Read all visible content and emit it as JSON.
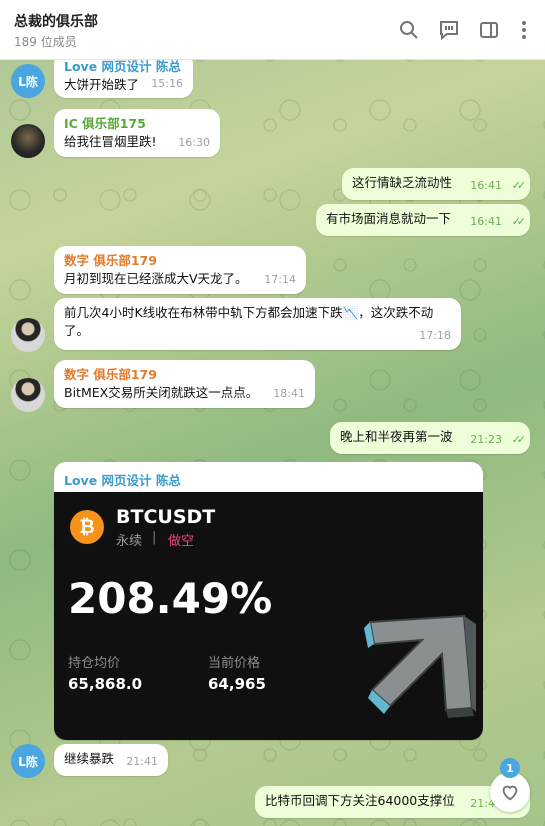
{
  "header": {
    "title": "总裁的俱乐部",
    "subtitle": "189 位成员"
  },
  "icons": {
    "search": "search-icon",
    "comments": "comments-icon",
    "sidebar": "sidebar-icon",
    "more": "more-vert-icon",
    "heart": "heart-icon"
  },
  "colors": {
    "love_sender": "#3a9bd0",
    "ic_sender": "#5ba83a",
    "digit_sender": "#e07b2f",
    "outgoing_bg": "#eefed9",
    "read_check": "#5fae4f"
  },
  "messages": [
    {
      "avatar": "L陈",
      "sender": "Love 网页设计 陈总",
      "text": "大饼开始跌了",
      "time": "15:16"
    },
    {
      "sender": "IC 俱乐部",
      "sender_num": "175",
      "text": "给我往冒烟里跌!",
      "time": "16:30"
    },
    {
      "text": "这行情缺乏流动性",
      "time": "16:41",
      "check": "✓✓"
    },
    {
      "text": "有市场面消息就动一下",
      "time": "16:41",
      "check": "✓✓"
    },
    {
      "sender": "数字 俱乐部",
      "sender_num": "179",
      "text": "月初到现在已经涨成大V天龙了。",
      "time": "17:14"
    },
    {
      "text_a": "前几次4小时K线收在布林带中轨下方都会加速下跌",
      "emoji": "📉",
      "text_b": "，这次跌不动",
      "text_c": "了。",
      "time": "17:18"
    },
    {
      "sender": "数字 俱乐部",
      "sender_num": "179",
      "text": "BitMEX交易所关闭就跌这一点点。",
      "time": "18:41"
    },
    {
      "text": "晚上和半夜再第一波",
      "time": "21:23",
      "check": "✓✓"
    },
    {
      "sender": "Love 网页设计 陈总"
    },
    {
      "avatar": "L陈",
      "text": "继续暴跌",
      "time": "21:41"
    },
    {
      "text": "比特币回调下方关注64000支撑位",
      "time": "21:47"
    }
  ],
  "poster": {
    "coin_symbol": "₿",
    "pair": "BTCUSDT",
    "perp": "永续",
    "sep": "|",
    "side": "做空",
    "pnl": "208.49%",
    "entry_label": "持仓均价",
    "entry_value": "65,868.0",
    "price_label": "当前价格",
    "price_value": "64,965"
  },
  "reaction_count": "1"
}
